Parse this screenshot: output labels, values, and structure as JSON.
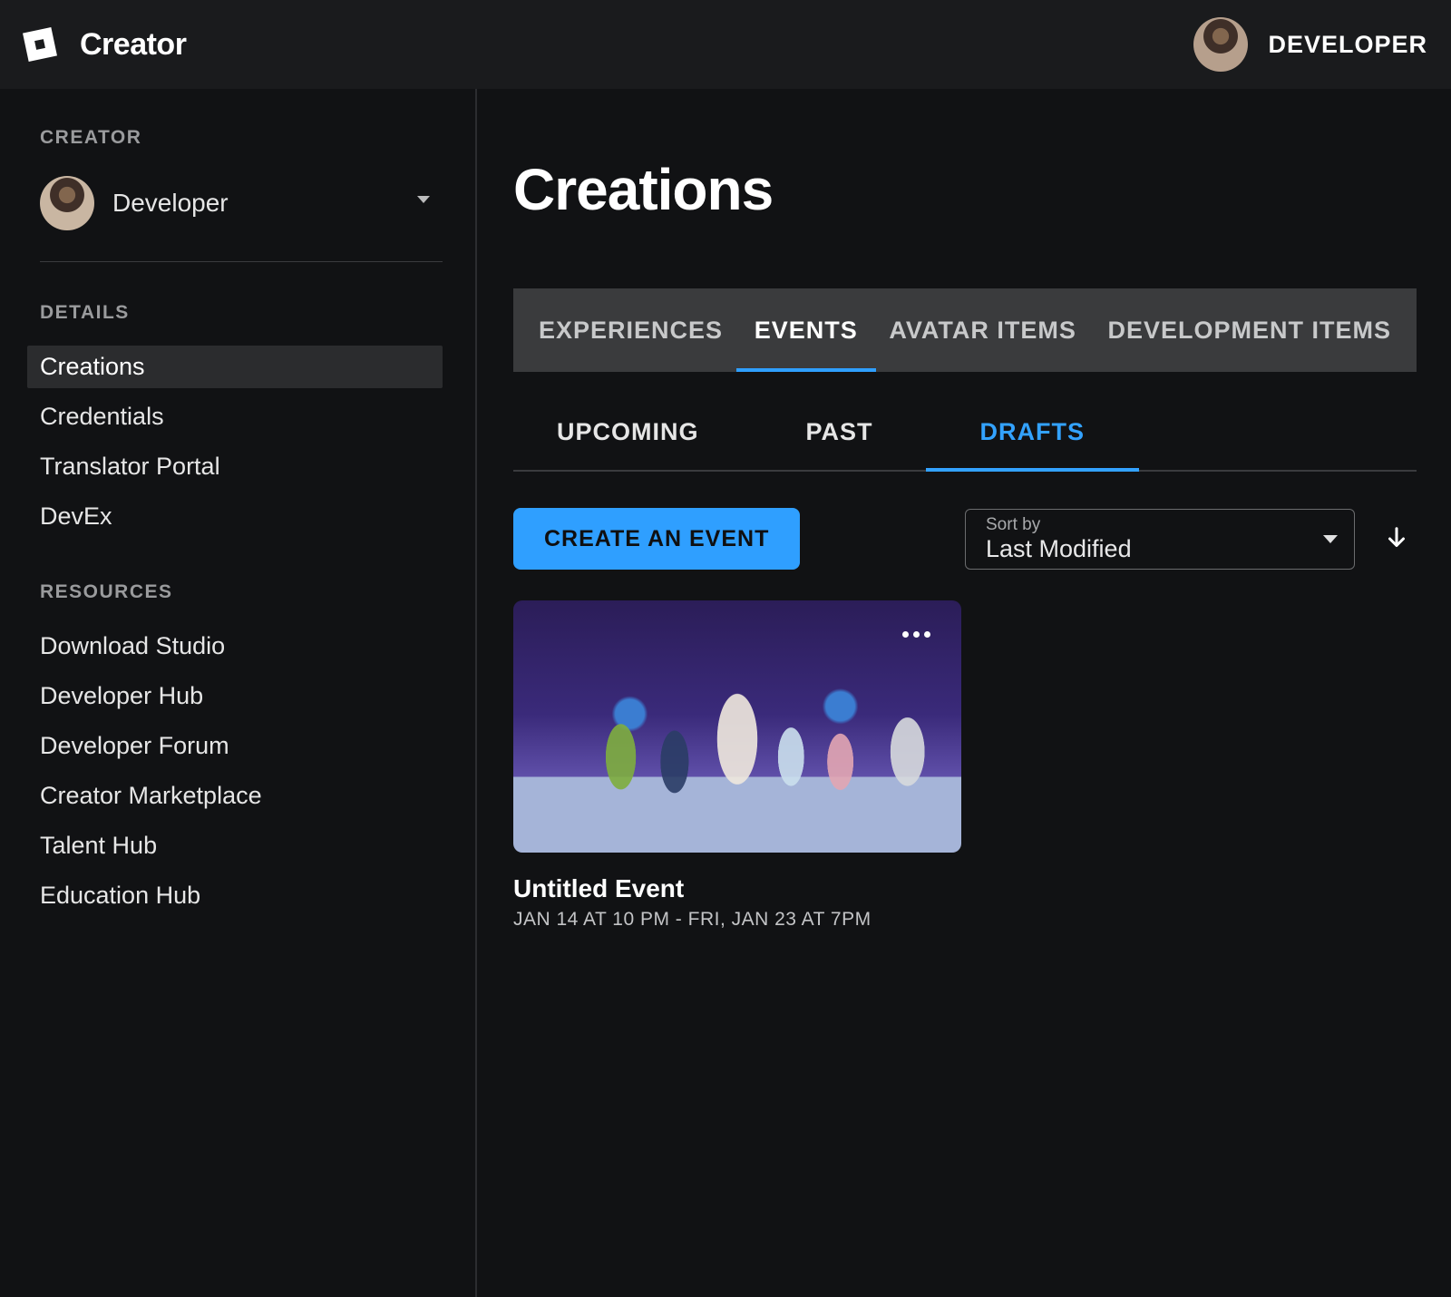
{
  "brand": {
    "name": "Creator"
  },
  "headerUser": {
    "name": "DEVELOPER"
  },
  "sidebar": {
    "creatorHeading": "CREATOR",
    "account": {
      "name": "Developer"
    },
    "detailsHeading": "DETAILS",
    "detailsItems": [
      {
        "label": "Creations",
        "active": true
      },
      {
        "label": "Credentials",
        "active": false
      },
      {
        "label": "Translator Portal",
        "active": false
      },
      {
        "label": "DevEx",
        "active": false
      }
    ],
    "resourcesHeading": "RESOURCES",
    "resourcesItems": [
      {
        "label": "Download Studio"
      },
      {
        "label": "Developer Hub"
      },
      {
        "label": "Developer Forum"
      },
      {
        "label": "Creator Marketplace"
      },
      {
        "label": "Talent Hub"
      },
      {
        "label": "Education Hub"
      }
    ]
  },
  "main": {
    "title": "Creations",
    "topTabs": [
      {
        "label": "EXPERIENCES",
        "active": false
      },
      {
        "label": "EVENTS",
        "active": true
      },
      {
        "label": "AVATAR ITEMS",
        "active": false
      },
      {
        "label": "DEVELOPMENT ITEMS",
        "active": false
      }
    ],
    "subTabs": [
      {
        "label": "UPCOMING",
        "active": false
      },
      {
        "label": "PAST",
        "active": false
      },
      {
        "label": "DRAFTS",
        "active": true
      }
    ],
    "createButton": "CREATE AN EVENT",
    "sort": {
      "label": "Sort by",
      "value": "Last Modified"
    },
    "events": [
      {
        "title": "Untitled Event",
        "dateRange": "JAN 14 AT 10 PM - FRI, JAN 23 AT 7PM"
      }
    ]
  }
}
